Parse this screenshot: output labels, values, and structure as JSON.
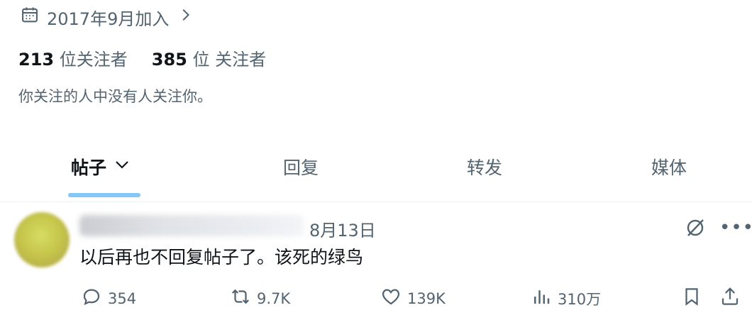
{
  "profile": {
    "joined": "2017年9月加入",
    "following_count": "213",
    "following_label": "位关注者",
    "followers_count": "385",
    "followers_label": "位 关注者",
    "mutual_note": "你关注的人中没有人关注你。"
  },
  "tabs": [
    {
      "label": "帖子",
      "active": true
    },
    {
      "label": "回复",
      "active": false
    },
    {
      "label": "转发",
      "active": false
    },
    {
      "label": "媒体",
      "active": false
    }
  ],
  "post": {
    "date": "8月13日",
    "text": "以后再也不回复帖子了。该死的绿鸟",
    "replies": "354",
    "reposts": "9.7K",
    "likes": "139K",
    "views": "310万"
  },
  "icons": {
    "joined": "calendar-icon",
    "joined_more": "chevron-right-icon",
    "tab_dropdown": "chevron-down-icon",
    "grok": "grok-icon",
    "more": "more-icon",
    "reply": "reply-icon",
    "repost": "repost-icon",
    "like": "heart-icon",
    "views": "views-icon",
    "bookmark": "bookmark-icon",
    "share": "share-icon"
  },
  "colors": {
    "text_primary": "#0f1419",
    "text_secondary": "#536471",
    "accent": "#1d9bf0"
  }
}
